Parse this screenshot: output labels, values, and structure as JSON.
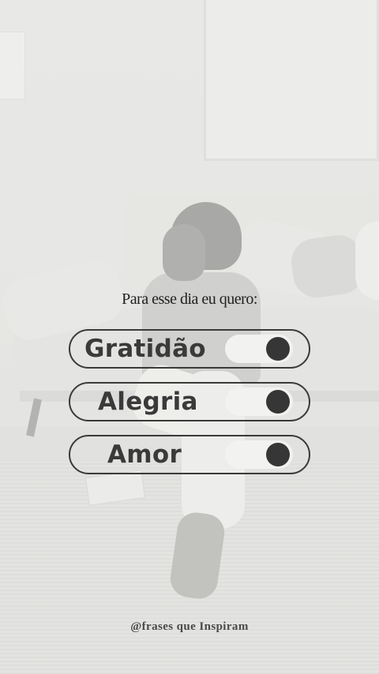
{
  "heading": "Para esse dia eu quero:",
  "toggles": [
    {
      "label": "Gratidão",
      "on": true
    },
    {
      "label": "Alegria",
      "on": true
    },
    {
      "label": "Amor",
      "on": true
    }
  ],
  "footer": "@frases que Inspiram",
  "colors": {
    "text": "#3a3a3a",
    "knob": "#363636",
    "switch_track": "#f2f2f0"
  }
}
